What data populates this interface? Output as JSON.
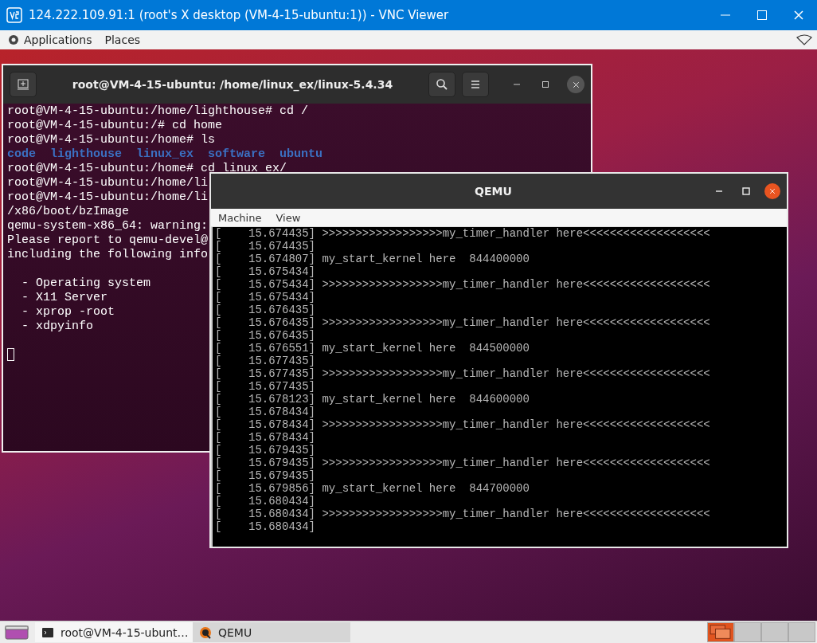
{
  "vnc_window": {
    "title": "124.222.109.91:1 (root's X desktop (VM-4-15-ubuntu:1)) - VNC Viewer"
  },
  "top_panel": {
    "menus": [
      "Applications",
      "Places"
    ]
  },
  "terminal": {
    "title": "root@VM-4-15-ubuntu: /home/linux_ex/linux-5.4.34",
    "lines": [
      {
        "kind": "output",
        "text": "root@VM-4-15-ubuntu:/home/lighthouse# cd /"
      },
      {
        "kind": "output",
        "text": "root@VM-4-15-ubuntu:/# cd home"
      },
      {
        "kind": "output",
        "text": "root@VM-4-15-ubuntu:/home# ls"
      },
      {
        "kind": "listing",
        "items": [
          "code",
          "lighthouse",
          "linux_ex",
          "software",
          "ubuntu"
        ]
      },
      {
        "kind": "output",
        "text": "root@VM-4-15-ubuntu:/home# cd linux_ex/"
      },
      {
        "kind": "output",
        "text": "root@VM-4-15-ubuntu:/home/li"
      },
      {
        "kind": "output",
        "text": "root@VM-4-15-ubuntu:/home/li"
      },
      {
        "kind": "output",
        "text": "/x86/boot/bzImage"
      },
      {
        "kind": "output",
        "text": "qemu-system-x86_64: warning:"
      },
      {
        "kind": "output",
        "text": "Please report to qemu-devel@"
      },
      {
        "kind": "output",
        "text": "including the following info"
      },
      {
        "kind": "output",
        "text": "  - Operating system",
        "blank_before": true
      },
      {
        "kind": "output",
        "text": "  - X11 Server"
      },
      {
        "kind": "output",
        "text": "  - xprop -root"
      },
      {
        "kind": "output",
        "text": "  - xdpyinfo"
      },
      {
        "kind": "cursor",
        "blank_before": true
      }
    ]
  },
  "qemu": {
    "title": "QEMU",
    "menus": [
      "Machine",
      "View"
    ],
    "console_lines": [
      "[    15.674435] >>>>>>>>>>>>>>>>>>my_timer_handler here<<<<<<<<<<<<<<<<<<<",
      "[    15.674435]",
      "[    15.674807] my_start_kernel here  844400000",
      "[    15.675434]",
      "[    15.675434] >>>>>>>>>>>>>>>>>>my_timer_handler here<<<<<<<<<<<<<<<<<<<",
      "[    15.675434]",
      "[    15.676435]",
      "[    15.676435] >>>>>>>>>>>>>>>>>>my_timer_handler here<<<<<<<<<<<<<<<<<<<",
      "[    15.676435]",
      "[    15.676551] my_start_kernel here  844500000",
      "[    15.677435]",
      "[    15.677435] >>>>>>>>>>>>>>>>>>my_timer_handler here<<<<<<<<<<<<<<<<<<<",
      "[    15.677435]",
      "[    15.678123] my_start_kernel here  844600000",
      "[    15.678434]",
      "[    15.678434] >>>>>>>>>>>>>>>>>>my_timer_handler here<<<<<<<<<<<<<<<<<<<",
      "[    15.678434]",
      "[    15.679435]",
      "[    15.679435] >>>>>>>>>>>>>>>>>>my_timer_handler here<<<<<<<<<<<<<<<<<<<",
      "[    15.679435]",
      "[    15.679856] my_start_kernel here  844700000",
      "[    15.680434]",
      "[    15.680434] >>>>>>>>>>>>>>>>>>my_timer_handler here<<<<<<<<<<<<<<<<<<<",
      "[    15.680434]"
    ]
  },
  "taskbar": {
    "items": [
      {
        "label": "root@VM-4-15-ubunt…",
        "kind": "terminal",
        "selected": false
      },
      {
        "label": "QEMU",
        "kind": "qemu",
        "selected": true
      }
    ],
    "workspaces": [
      {
        "selected": true
      },
      {
        "selected": false
      },
      {
        "selected": false
      },
      {
        "selected": false
      }
    ]
  }
}
